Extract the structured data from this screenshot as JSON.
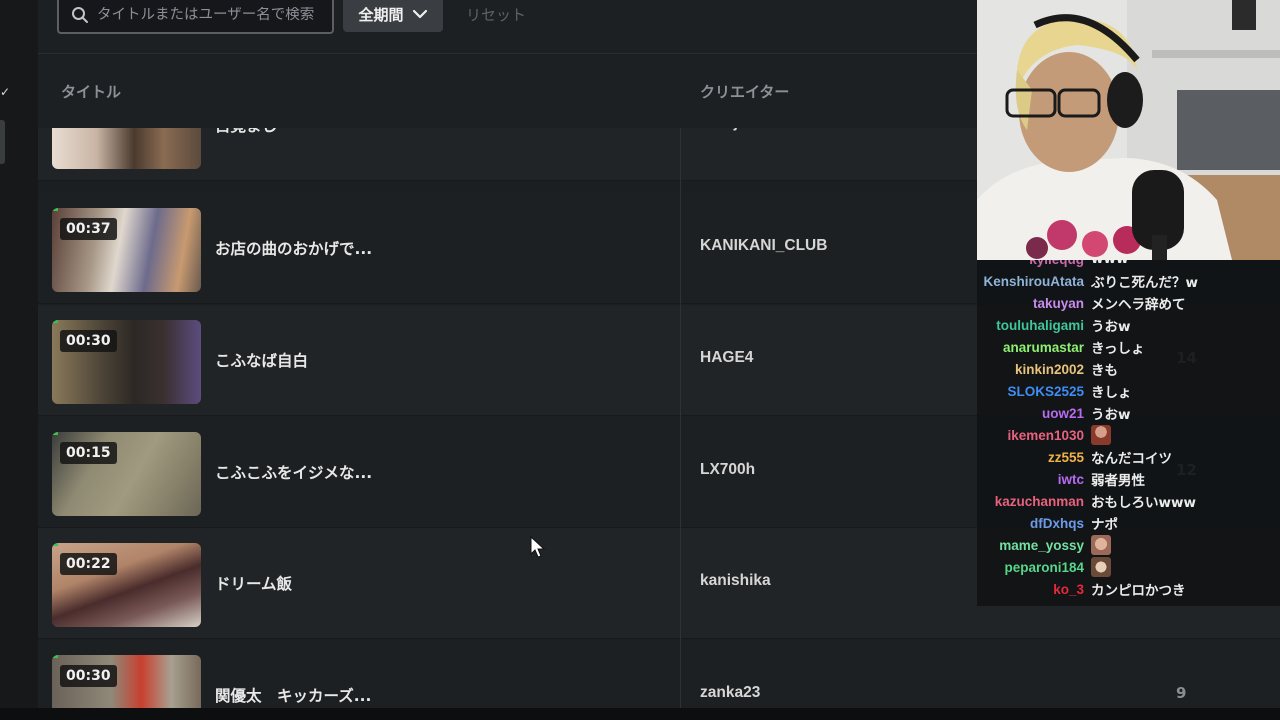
{
  "search": {
    "placeholder": "タイトルまたはユーザー名で検索"
  },
  "filters": {
    "period_label": "全期間",
    "reset_label": "リセット"
  },
  "table": {
    "headers": {
      "title": "タイトル",
      "creator": "クリエイター"
    },
    "rows": [
      {
        "duration": "",
        "title": "目覚まし",
        "creator": "ddtujbcdru",
        "count": ""
      },
      {
        "duration": "00:37",
        "title": "お店の曲のおかげで...",
        "creator": "KANIKANI_CLUB",
        "count": ""
      },
      {
        "duration": "00:30",
        "title": "こふなば自白",
        "creator": "HAGE4",
        "count": "14"
      },
      {
        "duration": "00:15",
        "title": "こふこふをイジメな...",
        "creator": "LX700h",
        "count": "12"
      },
      {
        "duration": "00:22",
        "title": "ドリーム飯",
        "creator": "kanishika",
        "count": ""
      },
      {
        "duration": "00:30",
        "title": "関優太　キッカーズ...",
        "creator": "zanka23",
        "count": "9"
      }
    ]
  },
  "chat": {
    "partial_top": {
      "user": "kyliequg",
      "text": "www"
    },
    "messages": [
      {
        "user": "KenshirouAtata",
        "color": "#8fb3d9",
        "text": "ぶりこ死んだ？w"
      },
      {
        "user": "takuyan",
        "color": "#c88cf0",
        "text": "メンヘラ辞めて"
      },
      {
        "user": "touluhaligami",
        "color": "#3fc69a",
        "text": "うおw"
      },
      {
        "user": "anarumastar",
        "color": "#8ef070",
        "text": "きっしょ"
      },
      {
        "user": "kinkin2002",
        "color": "#e8c47a",
        "text": "きも"
      },
      {
        "user": "SLOKS2525",
        "color": "#3f8df2",
        "text": "きしょ"
      },
      {
        "user": "uow21",
        "color": "#b76cf0",
        "text": "うおw"
      },
      {
        "user": "ikemen1030",
        "color": "#e8627e",
        "text": "",
        "emote": "person-emote"
      },
      {
        "user": "zz555",
        "color": "#f2b24a",
        "text": "なんだコイツ"
      },
      {
        "user": "iwtc",
        "color": "#b66cf0",
        "text": "弱者男性"
      },
      {
        "user": "kazuchanman",
        "color": "#e8627e",
        "text": "おもしろいwww"
      },
      {
        "user": "dfDxhqs",
        "color": "#6e9be8",
        "text": "ナポ"
      },
      {
        "user": "mame_yossy",
        "color": "#72e0a0",
        "text": "",
        "emote": "face-emote"
      },
      {
        "user": "peparoni184",
        "color": "#56d68a",
        "text": "",
        "emote": "face-emote-2"
      },
      {
        "user": "ko_3",
        "color": "#e8283c",
        "text": "カンピロかつき"
      }
    ]
  },
  "colors": {
    "accent_green": "#3fbf52",
    "background": "#1c1f21"
  }
}
